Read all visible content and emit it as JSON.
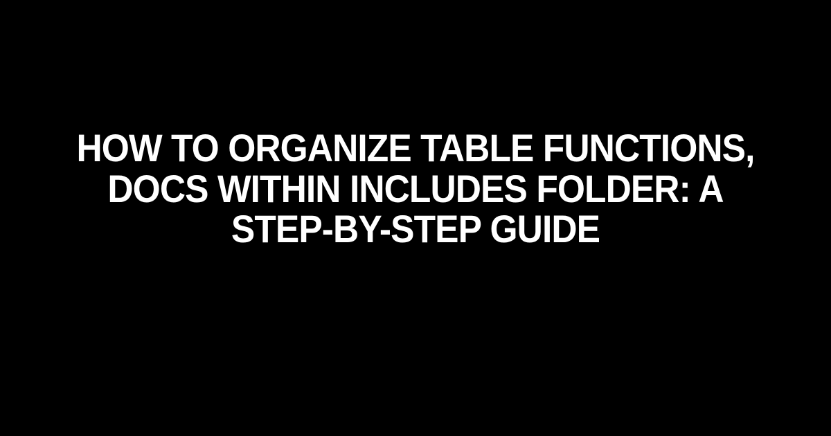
{
  "title": "How to Organize Table Functions, Docs within Includes Folder: A Step-by-Step Guide"
}
